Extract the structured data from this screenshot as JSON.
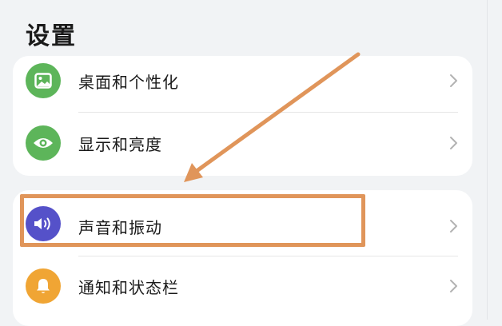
{
  "page": {
    "title": "设置"
  },
  "settings_groups": [
    {
      "items": [
        {
          "label": "桌面和个性化",
          "icon": "image-icon",
          "icon_color": "#5db55a"
        },
        {
          "label": "显示和亮度",
          "icon": "eye-icon",
          "icon_color": "#5db55a"
        }
      ]
    },
    {
      "items": [
        {
          "label": "声音和振动",
          "icon": "speaker-icon",
          "icon_color": "#5551c9"
        },
        {
          "label": "通知和状态栏",
          "icon": "bell-icon",
          "icon_color": "#f0a534"
        }
      ]
    }
  ],
  "annotation": {
    "color": "#e0955a",
    "highlighted_item": "声音和振动"
  },
  "colors": {
    "background": "#f1f3f5",
    "card": "#ffffff",
    "chevron": "#b3b3b3"
  }
}
